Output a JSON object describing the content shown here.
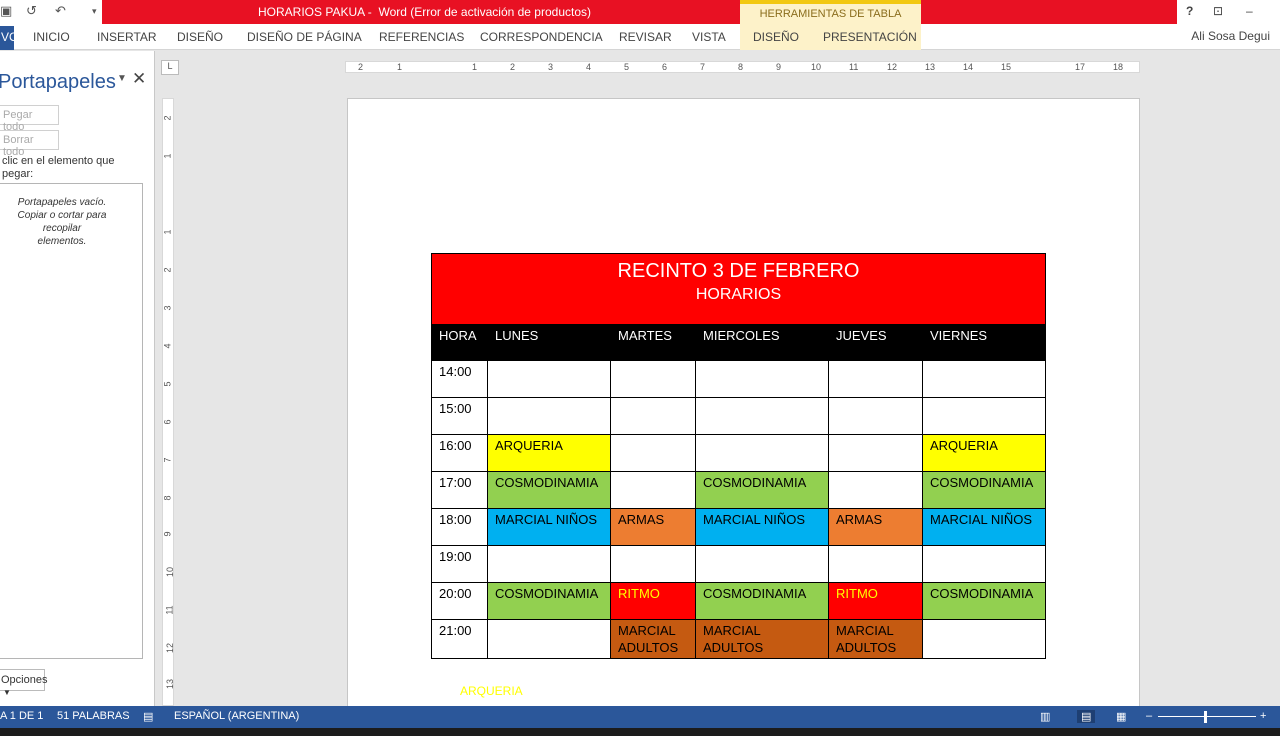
{
  "window": {
    "title": "HORARIOS PAKUA -  Word (Error de activación de productos)",
    "context_tab_group": "HERRAMIENTAS DE TABLA",
    "help": "?",
    "minimize": "–"
  },
  "ribbon": {
    "tabs": [
      "VO",
      "INICIO",
      "INSERTAR",
      "DISEÑO",
      "DISEÑO DE PÁGINA",
      "REFERENCIAS",
      "CORRESPONDENCIA",
      "REVISAR",
      "VISTA",
      "DISEÑO",
      "PRESENTACIÓN"
    ],
    "user": "Ali Sosa Degui"
  },
  "clipboard_pane": {
    "title": "Portapapeles",
    "paste_all": "Pegar todo",
    "clear_all": "Borrar todo",
    "hint_line1": "clic en el elemento que",
    "hint_line2": "pegar:",
    "empty_line1": "Portapapeles vacío.",
    "empty_line2": "Copiar o cortar para recopilar",
    "empty_line3": "elementos.",
    "options": "Opciones"
  },
  "ruler": {
    "h_ticks": [
      "2",
      "1",
      "1",
      "2",
      "3",
      "4",
      "5",
      "6",
      "7",
      "8",
      "9",
      "10",
      "11",
      "12",
      "13",
      "14",
      "15",
      "17",
      "18"
    ],
    "v_ticks": [
      "2",
      "1",
      "1",
      "2",
      "3",
      "4",
      "5",
      "6",
      "7",
      "8",
      "9",
      "10",
      "11",
      "12",
      "13"
    ]
  },
  "table": {
    "title": "RECINTO 3 DE FEBRERO",
    "subtitle": "HORARIOS",
    "columns": [
      "HORA",
      "LUNES",
      "MARTES",
      "MIERCOLES",
      "JUEVES",
      "VIERNES"
    ],
    "rows": [
      {
        "hour": "14:00",
        "cells": [
          {
            "text": "",
            "color": ""
          },
          {
            "text": "",
            "color": ""
          },
          {
            "text": "",
            "color": ""
          },
          {
            "text": "",
            "color": ""
          },
          {
            "text": "",
            "color": ""
          }
        ]
      },
      {
        "hour": "15:00",
        "cells": [
          {
            "text": "",
            "color": ""
          },
          {
            "text": "",
            "color": ""
          },
          {
            "text": "",
            "color": ""
          },
          {
            "text": "",
            "color": ""
          },
          {
            "text": "",
            "color": ""
          }
        ]
      },
      {
        "hour": "16:00",
        "cells": [
          {
            "text": "ARQUERIA",
            "color": "c-yel"
          },
          {
            "text": "",
            "color": ""
          },
          {
            "text": "",
            "color": ""
          },
          {
            "text": "",
            "color": ""
          },
          {
            "text": "ARQUERIA",
            "color": "c-yel"
          }
        ]
      },
      {
        "hour": "17:00",
        "cells": [
          {
            "text": "COSMODINAMIA",
            "color": "c-grn"
          },
          {
            "text": "",
            "color": ""
          },
          {
            "text": "COSMODINAMIA",
            "color": "c-grn"
          },
          {
            "text": "",
            "color": ""
          },
          {
            "text": "COSMODINAMIA",
            "color": "c-grn"
          }
        ]
      },
      {
        "hour": "18:00",
        "cells": [
          {
            "text": "MARCIAL NIÑOS",
            "color": "c-blu"
          },
          {
            "text": "ARMAS",
            "color": "c-org"
          },
          {
            "text": "MARCIAL NIÑOS",
            "color": "c-blu"
          },
          {
            "text": "ARMAS",
            "color": "c-org"
          },
          {
            "text": "MARCIAL NIÑOS",
            "color": "c-blu"
          }
        ]
      },
      {
        "hour": "19:00",
        "cells": [
          {
            "text": "",
            "color": ""
          },
          {
            "text": "",
            "color": ""
          },
          {
            "text": "",
            "color": ""
          },
          {
            "text": "",
            "color": ""
          },
          {
            "text": "",
            "color": ""
          }
        ]
      },
      {
        "hour": "20:00",
        "cells": [
          {
            "text": "COSMODINAMIA",
            "color": "c-grn"
          },
          {
            "text": "RITMO",
            "color": "c-red"
          },
          {
            "text": "COSMODINAMIA",
            "color": "c-grn"
          },
          {
            "text": "RITMO",
            "color": "c-red"
          },
          {
            "text": "COSMODINAMIA",
            "color": "c-grn"
          }
        ]
      },
      {
        "hour": "21:00",
        "cells": [
          {
            "text": "",
            "color": ""
          },
          {
            "text": "MARCIAL ADULTOS",
            "color": "c-brn"
          },
          {
            "text": "MARCIAL ADULTOS",
            "color": "c-brn"
          },
          {
            "text": "MARCIAL ADULTOS",
            "color": "c-brn"
          },
          {
            "text": "",
            "color": ""
          }
        ]
      }
    ]
  },
  "below_table_text": "ARQUERIA",
  "status": {
    "page": "A 1 DE 1",
    "words": "51 PALABRAS",
    "language": "ESPAÑOL (ARGENTINA)",
    "zoom_minus": "–",
    "zoom_plus": "+"
  },
  "colors": {
    "word_blue": "#2b579a",
    "title_red": "#e81123",
    "header_red": "#ff0000",
    "yellow": "#ffff00",
    "green": "#92d050",
    "blue": "#00b0f0",
    "orange": "#ed7d31",
    "brown": "#c55a11"
  }
}
